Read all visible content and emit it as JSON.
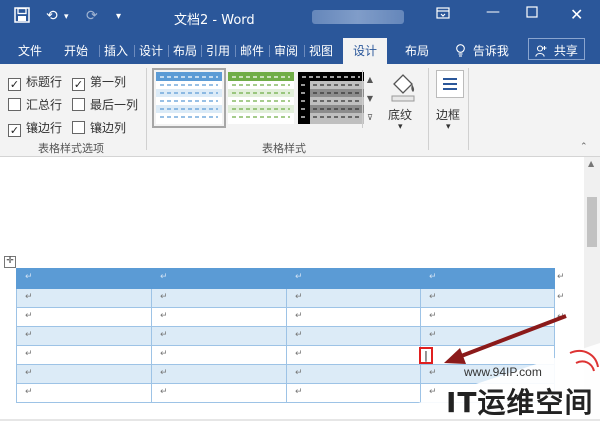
{
  "titlebar": {
    "title": "文档2  -  Word",
    "save_icon": "save-icon",
    "undo_icon": "undo-icon",
    "redo_icon": "redo-icon",
    "customize_icon": "customize-qat-icon"
  },
  "tabs": {
    "file": "文件",
    "home": "开始",
    "insert": "插入",
    "design": "设计",
    "layout": "布局",
    "references": "引用",
    "mailings": "邮件",
    "review": "审阅",
    "view": "视图",
    "table_design": "设计",
    "table_layout": "布局",
    "tell_me": "告诉我",
    "share": "共享"
  },
  "ribbon": {
    "options": {
      "header_row": {
        "label": "标题行",
        "checked": true
      },
      "first_column": {
        "label": "第一列",
        "checked": true
      },
      "total_row": {
        "label": "汇总行",
        "checked": false
      },
      "last_column": {
        "label": "最后一列",
        "checked": false
      },
      "banded_rows": {
        "label": "镶边行",
        "checked": true
      },
      "banded_columns": {
        "label": "镶边列",
        "checked": false
      },
      "group_label": "表格样式选项"
    },
    "styles": {
      "group_label": "表格样式",
      "shading_label": "底纹",
      "borders_label": "边框",
      "thumb_colors": [
        "#5b9bd5",
        "#70ad47",
        "#404040"
      ]
    }
  },
  "document": {
    "paragraph_mark": "↵",
    "cursor_mark": "|",
    "table_rows": 7,
    "table_cols": 4,
    "header_color": "#5b9bd5",
    "band_color": "#dcebf7"
  },
  "watermark": {
    "url": "www.94IP.com",
    "brand": "IT运维空间"
  },
  "colors": {
    "accent": "#2b579a",
    "highlight": "#e02020",
    "arrow": "#8b1a1a"
  }
}
